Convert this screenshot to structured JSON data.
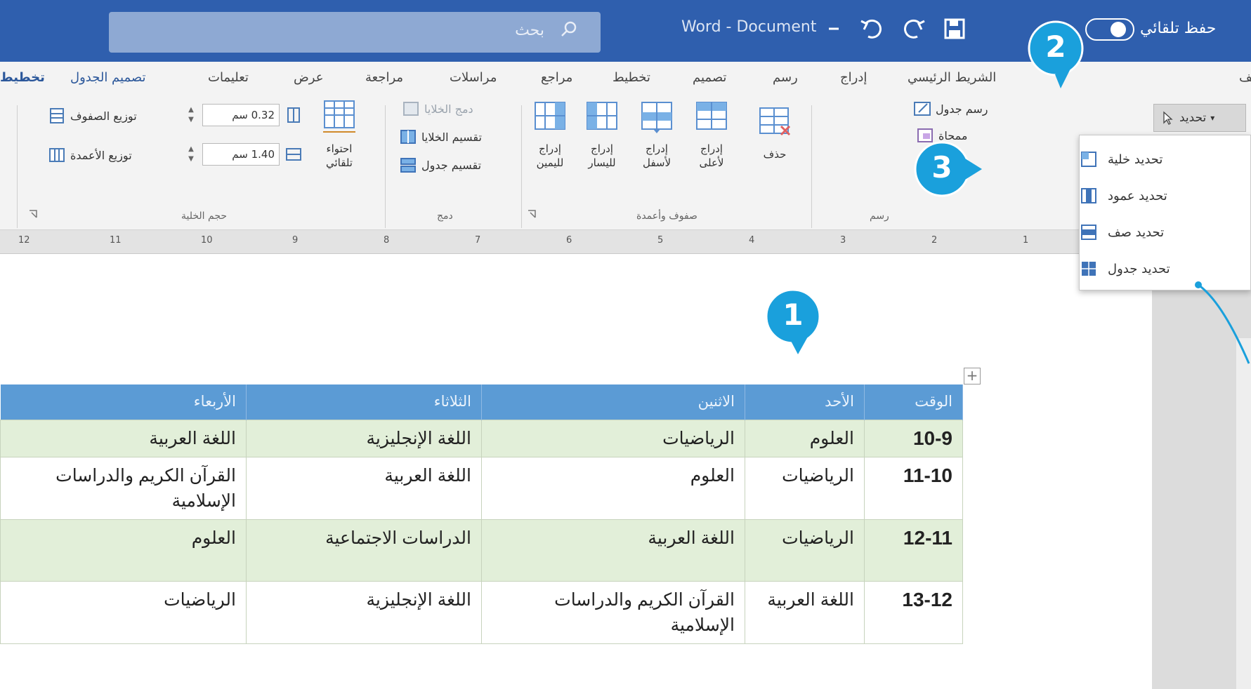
{
  "titlebar": {
    "search_label": "بحث",
    "doc_title": "Word - Document",
    "autosave_label": "حفظ تلقائي"
  },
  "ribbon": {
    "tabs": [
      {
        "label": "ملف"
      },
      {
        "label": "الشريط الرئيسي"
      },
      {
        "label": "إدراج"
      },
      {
        "label": "رسم"
      },
      {
        "label": "تصميم"
      },
      {
        "label": "تخطيط"
      },
      {
        "label": "مراجع"
      },
      {
        "label": "مراسلات"
      },
      {
        "label": "مراجعة"
      },
      {
        "label": "عرض"
      },
      {
        "label": "تعليمات"
      },
      {
        "label": "تصميم الجدول"
      },
      {
        "label": "تخطيط"
      }
    ],
    "table_group": {
      "select_label": "تحديد",
      "draw_table_label": "رسم جدول",
      "eraser_label": "ممحاة",
      "label": "رسم"
    },
    "rows_cols_group": {
      "delete_label": "حذف",
      "insert_above_label": "إدراج\nلأعلى",
      "insert_below_label": "إدراج\nلأسفل",
      "insert_left_label": "إدراج\nلليسار",
      "insert_right_label": "إدراج\nلليمين",
      "label": "صفوف وأعمدة"
    },
    "merge_group": {
      "merge_cells_label": "دمج الخلايا",
      "split_cells_label": "تقسيم الخلايا",
      "split_table_label": "تقسيم جدول",
      "label": "دمج"
    },
    "cell_size_group": {
      "autofit_label": "احتواء\nتلقائي",
      "height_value": "0.32 سم",
      "width_value": "1.40 سم",
      "distribute_rows_label": "توزيع الصفوف",
      "distribute_cols_label": "توزيع الأعمدة",
      "label": "حجم الخلية"
    }
  },
  "ruler": {
    "numbers": [
      "12",
      "11",
      "10",
      "9",
      "8",
      "7",
      "6",
      "5",
      "4",
      "3",
      "2",
      "1"
    ]
  },
  "select_menu": {
    "items": [
      {
        "label": "تحديد خلية"
      },
      {
        "label": "تحديد عمود"
      },
      {
        "label": "تحديد صف"
      },
      {
        "label": "تحديد جدول"
      }
    ]
  },
  "table": {
    "headers": [
      "الوقت",
      "الأحد",
      "الاثنين",
      "الثلاثاء",
      "الأربعاء"
    ],
    "rows": [
      [
        "10-9",
        "العلوم",
        "الرياضيات",
        "اللغة الإنجليزية",
        "اللغة العربية"
      ],
      [
        "11-10",
        "الرياضيات",
        "العلوم",
        "اللغة العربية",
        "القرآن الكريم والدراسات الإسلامية"
      ],
      [
        "12-11",
        "الرياضيات",
        "اللغة العربية",
        "الدراسات الاجتماعية",
        "العلوم"
      ],
      [
        "13-12",
        "اللغة العربية",
        "القرآن الكريم والدراسات الإسلامية",
        "اللغة الإنجليزية",
        "الرياضيات"
      ]
    ]
  },
  "callouts": [
    "1",
    "2",
    "3"
  ],
  "colors": {
    "titlebar": "#2f5fae",
    "header_row": "#5b9bd5",
    "band_row": "#e2efd9",
    "callout": "#1aa0dc"
  }
}
